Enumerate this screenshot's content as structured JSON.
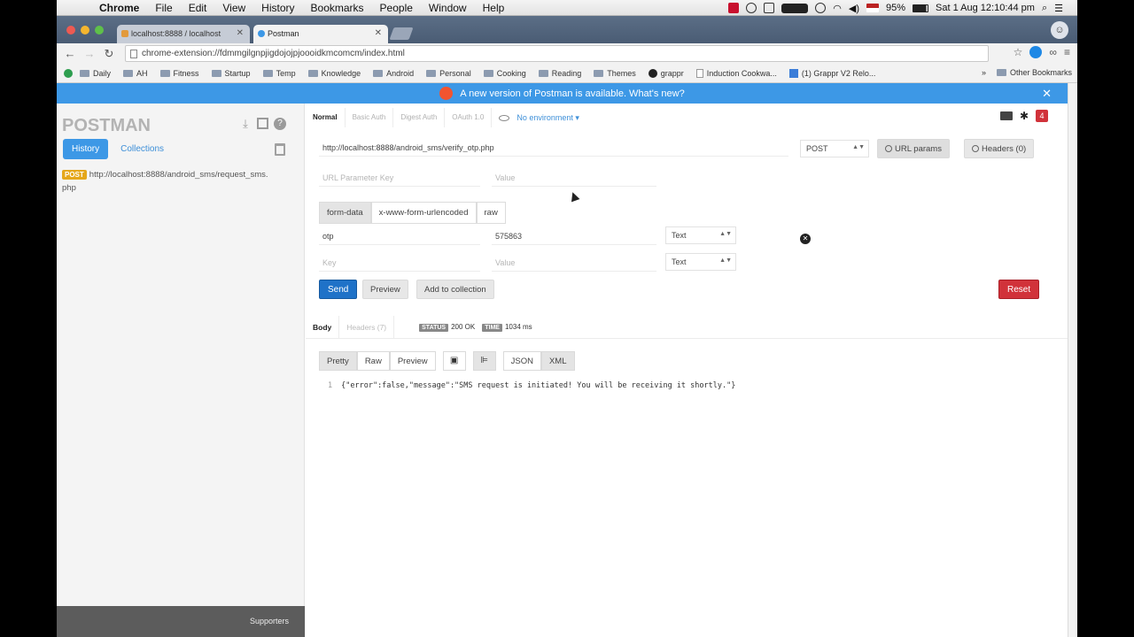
{
  "menubar": {
    "app": "Chrome",
    "items": [
      "File",
      "Edit",
      "View",
      "History",
      "Bookmarks",
      "People",
      "Window",
      "Help"
    ],
    "battery": "95%",
    "clock": "Sat 1 Aug  12:10:44 pm"
  },
  "tabs": [
    {
      "title": "localhost:8888 / localhost"
    },
    {
      "title": "Postman"
    }
  ],
  "address": "chrome-extension://fdmmgilgnpjigdojojpjoooidkmcomcm/index.html",
  "bookmarks": [
    {
      "label": "Daily",
      "icon": "folder"
    },
    {
      "label": "AH",
      "icon": "folder"
    },
    {
      "label": "Fitness",
      "icon": "folder"
    },
    {
      "label": "Startup",
      "icon": "folder"
    },
    {
      "label": "Temp",
      "icon": "folder"
    },
    {
      "label": "Knowledge",
      "icon": "folder"
    },
    {
      "label": "Android",
      "icon": "folder"
    },
    {
      "label": "Personal",
      "icon": "folder"
    },
    {
      "label": "Cooking",
      "icon": "folder"
    },
    {
      "label": "Reading",
      "icon": "folder"
    },
    {
      "label": "Themes",
      "icon": "folder"
    },
    {
      "label": "grappr",
      "icon": "github"
    },
    {
      "label": "Induction Cookwa...",
      "icon": "doc"
    },
    {
      "label": "(1) Grappr V2 Relo...",
      "icon": "square"
    }
  ],
  "bookmarks_more": "»",
  "bookmarks_other": "Other Bookmarks",
  "banner": {
    "text": "A new version of Postman is available. What's new?",
    "close": "✕"
  },
  "sidebar": {
    "logo": "POSTMAN",
    "tabs": [
      "History",
      "Collections"
    ],
    "history": [
      {
        "method": "POST",
        "url": "http://localhost:8888/android_sms/request_sms.php"
      }
    ],
    "footer": "Supporters",
    "collapse": "«"
  },
  "auth_tabs": [
    "Normal",
    "Basic Auth",
    "Digest Auth",
    "OAuth 1.0"
  ],
  "environment": "No environment ▾",
  "notification_count": "4",
  "request": {
    "url": "http://localhost:8888/android_sms/verify_otp.php",
    "method": "POST",
    "url_params_label": "URL params",
    "headers_label": "Headers (0)",
    "param_key_placeholder": "URL Parameter Key",
    "param_value_placeholder": "Value"
  },
  "body_tabs": [
    "form-data",
    "x-www-form-urlencoded",
    "raw"
  ],
  "form_rows": [
    {
      "key": "otp",
      "value": "575863",
      "type": "Text"
    },
    {
      "key_placeholder": "Key",
      "value_placeholder": "Value",
      "type": "Text"
    }
  ],
  "actions": {
    "send": "Send",
    "preview": "Preview",
    "add_to_collection": "Add to collection",
    "reset": "Reset"
  },
  "response": {
    "tabs": [
      "Body",
      "Headers (7)"
    ],
    "status_label": "STATUS",
    "status_value": "200 OK",
    "time_label": "TIME",
    "time_value": "1034 ms",
    "format_buttons": [
      "Pretty",
      "Raw",
      "Preview"
    ],
    "format_types": [
      "JSON",
      "XML"
    ],
    "line_number": "1",
    "body": "{\"error\":false,\"message\":\"SMS request is initiated! You will be receiving it shortly.\"}"
  }
}
